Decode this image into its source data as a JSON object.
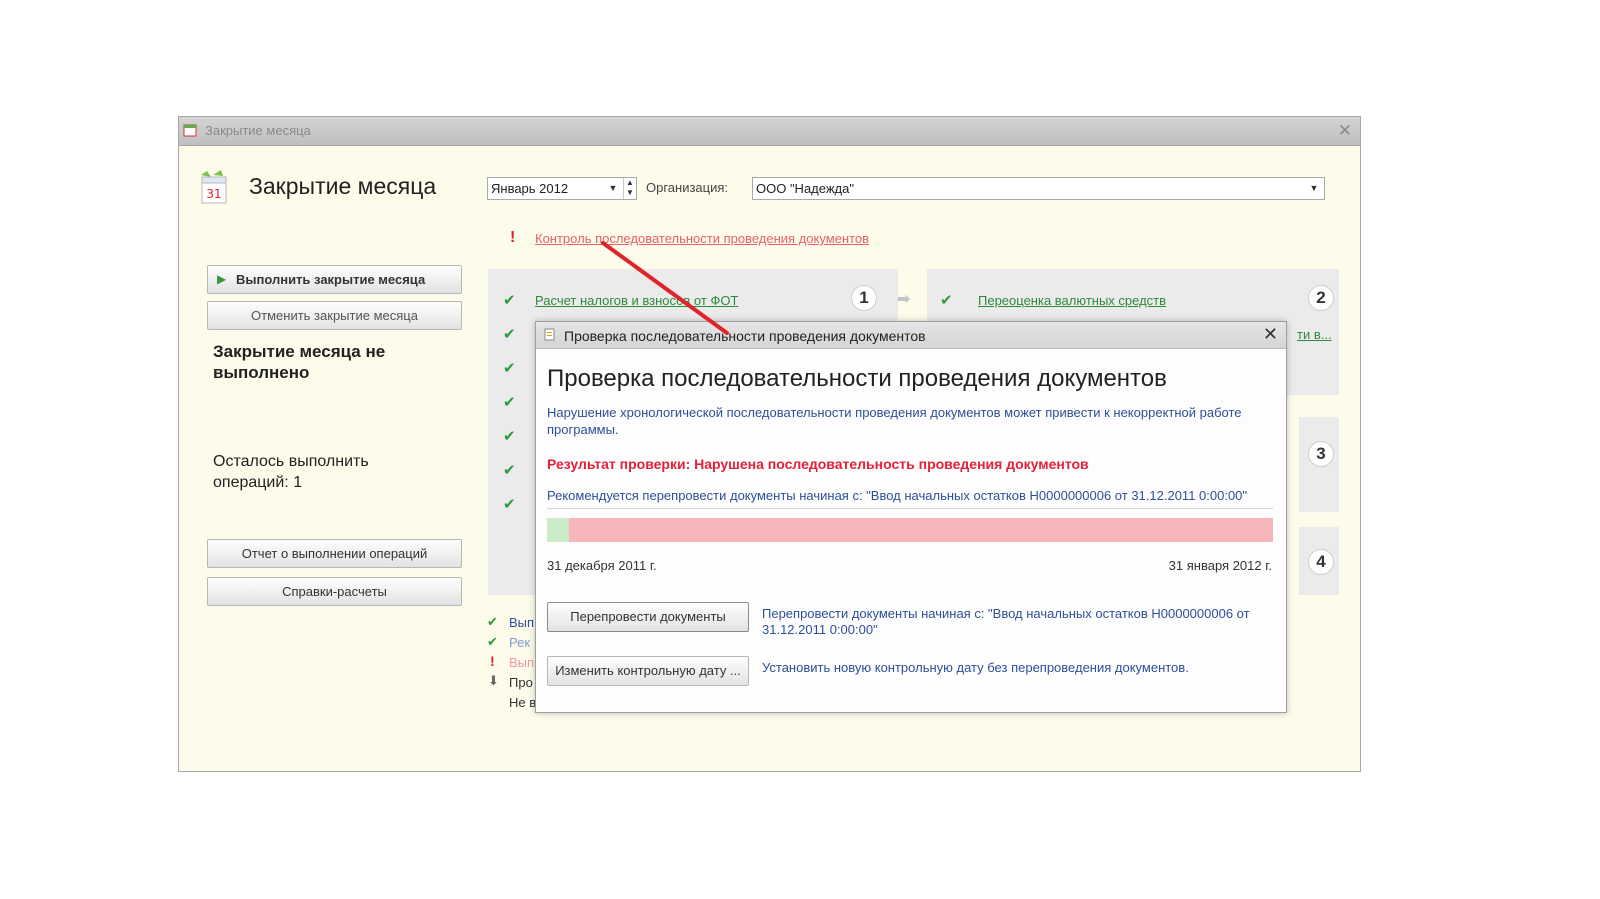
{
  "window": {
    "title": "Закрытие месяца",
    "close_glyph": "✕",
    "page_title": "Закрытие месяца",
    "calendar_day": "31"
  },
  "toolbar": {
    "period_value": "Январь 2012",
    "org_label": "Организация:",
    "org_value": "ООО \"Надежда\""
  },
  "left": {
    "run_button": "Выполнить закрытие месяца",
    "cancel_button": "Отменить закрытие месяца",
    "status": "Закрытие месяца не выполнено",
    "remaining": "Осталось выполнить операций: 1",
    "report_button": "Отчет о выполнении операций",
    "refs_button": "Справки-расчеты"
  },
  "warning_link": "Контроль последовательности проведения документов",
  "steps": {
    "step1_link": "Расчет налогов и взносов от ФОТ",
    "step2_link": "Переоценка валютных средств",
    "step2b_link": "ти в...",
    "numbers": [
      "1",
      "2",
      "3",
      "4"
    ]
  },
  "legend": [
    {
      "text": "Вып",
      "icon": "check-icon"
    },
    {
      "text": "Рек",
      "icon": "check-icon"
    },
    {
      "text": "Вып",
      "icon": "exclamation-icon"
    },
    {
      "text": "Про",
      "icon": "down-arrow-icon"
    },
    {
      "text": "Не в",
      "icon": ""
    }
  ],
  "dialog": {
    "title": "Проверка последовательности проведения документов",
    "heading": "Проверка последовательности проведения документов",
    "warning": "Нарушение хронологической последовательности проведения документов может привести к некорректной работе программы.",
    "result": "Результат проверки:  Нарушена последовательность проведения документов",
    "recommend": "Рекомендуется перепровести документы начиная с: \"Ввод начальных остатков Н0000000006 от 31.12.2011 0:00:00\"",
    "timeline_progress": 0.03,
    "date_start": "31 декабря 2011 г.",
    "date_end": "31 января 2012 г.",
    "repost_button": "Перепровести документы",
    "repost_desc": "Перепровести документы начиная с: \"Ввод начальных остатков Н0000000006 от 31.12.2011 0:00:00\"",
    "change_date_button": "Изменить контрольную дату ...",
    "change_date_desc": "Установить новую контрольную дату без перепроведения документов.",
    "close_glyph": "✕"
  },
  "colors": {
    "window_bg": "#fdfbea",
    "accent_red": "#e5213a",
    "link_green": "#2d8a3a",
    "text_blue": "#2e4f9a",
    "timeline_bad": "#f7b6b9",
    "timeline_ok": "#c9ecc7"
  }
}
